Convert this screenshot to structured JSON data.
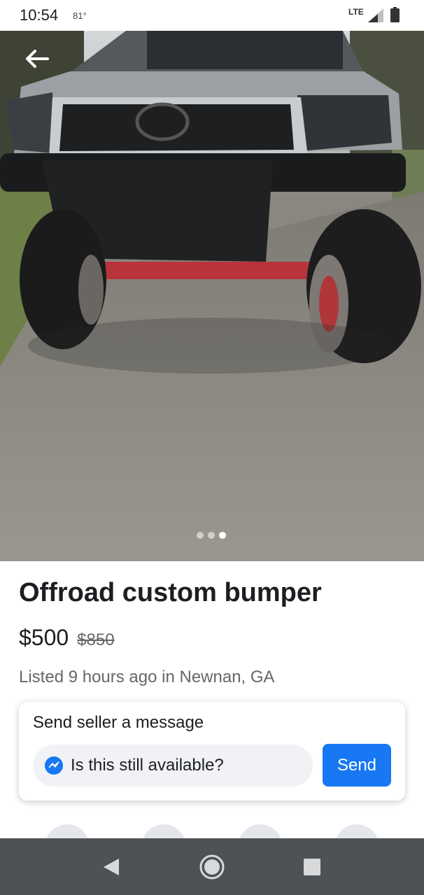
{
  "status_bar": {
    "time": "10:54",
    "temperature": "81°",
    "network": "LTE"
  },
  "photo": {
    "description_icon": "bumper-photo",
    "total_images": 3,
    "current_image": 3
  },
  "listing": {
    "title": "Offroad custom bumper",
    "price": "$500",
    "original_price": "$850",
    "listed_meta": "Listed 9 hours ago in Newnan, GA"
  },
  "message_card": {
    "title": "Send seller a message",
    "input_value": "Is this still available?",
    "send_label": "Send"
  },
  "colors": {
    "accent": "#1877f2",
    "nav_bar": "#4d5256",
    "input_bg": "#f0f2f5"
  }
}
